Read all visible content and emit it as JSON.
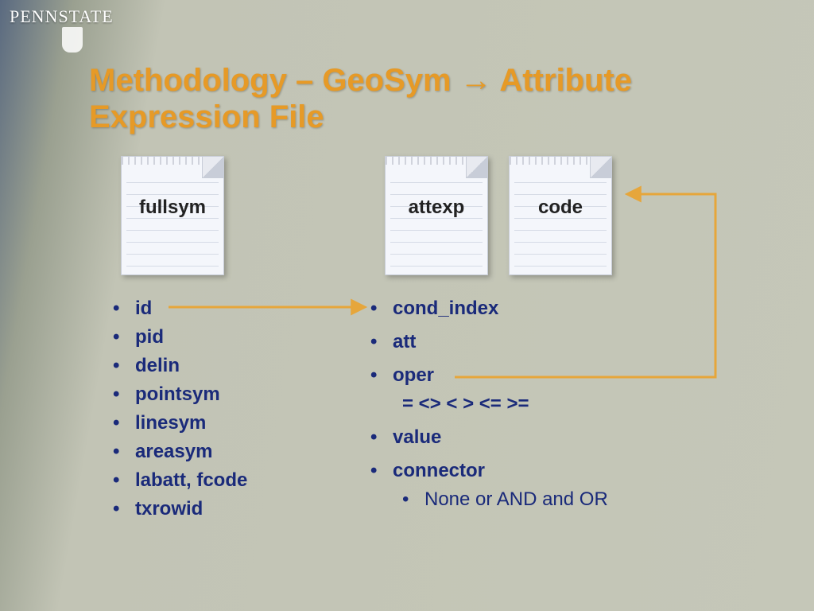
{
  "brand": {
    "name": "PENNSTATE"
  },
  "title": {
    "part1": "Methodology – GeoSym ",
    "arrow": "→",
    "part2": " Attribute Expression File"
  },
  "notepads": {
    "fullsym": "fullsym",
    "attexp": "attexp",
    "code": "code"
  },
  "left_list": {
    "i0": "id",
    "i1": "pid",
    "i2": "delin",
    "i3": "pointsym",
    "i4": "linesym",
    "i5": "areasym",
    "i6": "labatt, fcode",
    "i7": "txrowid"
  },
  "right_list": {
    "i0": "cond_index",
    "i1": "att",
    "i2": "oper",
    "sub_ops": "=  <>  <  >  <=  >=",
    "i3": "value",
    "i4": "connector",
    "sub_conn": "None or AND and OR"
  }
}
